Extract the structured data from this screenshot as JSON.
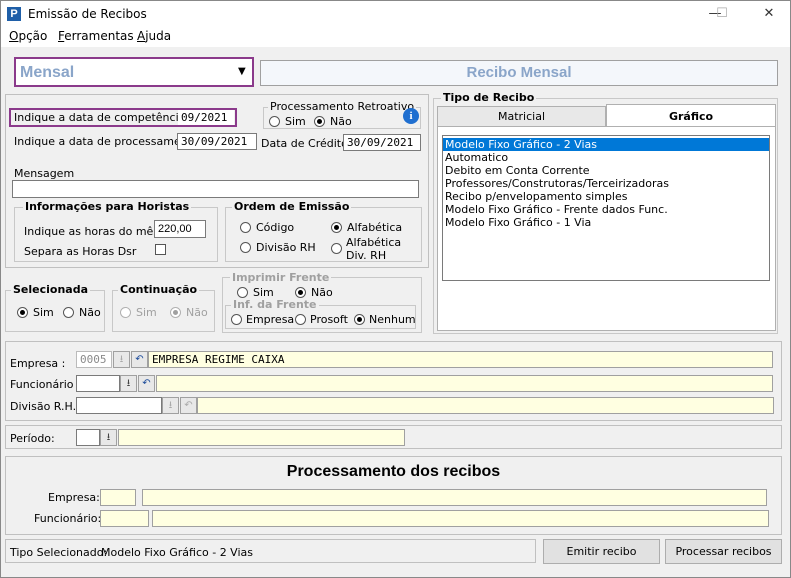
{
  "window": {
    "title": "Emissão de Recibos",
    "min": "—",
    "max": "☐",
    "close": "✕"
  },
  "menu": {
    "opcao": "Opção",
    "ferramentas": "Ferramentas",
    "ajuda": "Ajuda"
  },
  "tipo": {
    "combo_value": "Mensal",
    "banner": "Recibo Mensal"
  },
  "datas": {
    "competencia_label": "Indique a data de competência",
    "competencia_value": "09/2021",
    "processamento_label": "Indique a data de processamento",
    "processamento_value": "30/09/2021",
    "credito_label": "Data de Crédito",
    "credito_value": "30/09/2021"
  },
  "retroativo": {
    "title": "Processamento Retroativo",
    "sim": "Sim",
    "nao": "Não",
    "info": "i"
  },
  "mensagem": {
    "label": "Mensagem",
    "value": ""
  },
  "horistas": {
    "title": "Informações para Horistas",
    "horas_label": "Indique as horas do mês",
    "horas_value": "220,00",
    "dsr_label": "Separa as Horas Dsr"
  },
  "ordem": {
    "title": "Ordem de Emissão",
    "codigo": "Código",
    "divisao": "Divisão RH",
    "alfabetica": "Alfabética",
    "alfabetica_div_1": "Alfabética",
    "alfabetica_div_2": "Div.  RH"
  },
  "selecionada": {
    "title": "Selecionada",
    "sim": "Sim",
    "nao": "Não"
  },
  "continuacao": {
    "title": "Continuação",
    "sim": "Sim",
    "nao": "Não"
  },
  "imprimir": {
    "title": "Imprimir Frente",
    "sim": "Sim",
    "nao": "Não",
    "inf_title": "Inf. da Frente",
    "empresa": "Empresa",
    "prosoft": "Prosoft",
    "nenhum": "Nenhum"
  },
  "tipo_recibo": {
    "title": "Tipo de Recibo",
    "tab_matricial": "Matricial",
    "tab_grafico": "Gráfico",
    "items": [
      "Modelo Fixo Gráfico - 2 Vias",
      "Automatico",
      "Debito em Conta Corrente",
      "Professores/Construtoras/Terceirizadoras",
      "Recibo p/envelopamento simples",
      "Modelo Fixo Gráfico - Frente dados Func.",
      "Modelo Fixo Gráfico - 1 Via"
    ]
  },
  "filtros": {
    "empresa_label": "Empresa :",
    "empresa_code": "0005",
    "empresa_name": "EMPRESA REGIME CAIXA",
    "funcionario_label": "Funcionário :",
    "divisao_label": "Divisão R.H.:",
    "periodo_label": "Período:"
  },
  "processamento": {
    "title": "Processamento dos recibos",
    "empresa_label": "Empresa:",
    "funcionario_label": "Funcionário:"
  },
  "status": {
    "label": "Tipo Selecionado:",
    "value": "Modelo Fixo Gráfico - 2 Vias"
  },
  "buttons": {
    "emitir": "Emitir recibo",
    "processar": "Processar recibos"
  },
  "colors": {
    "highlight": "#8b3a8b",
    "banner_text": "#8aa5c9",
    "selection": "#0078d7"
  }
}
